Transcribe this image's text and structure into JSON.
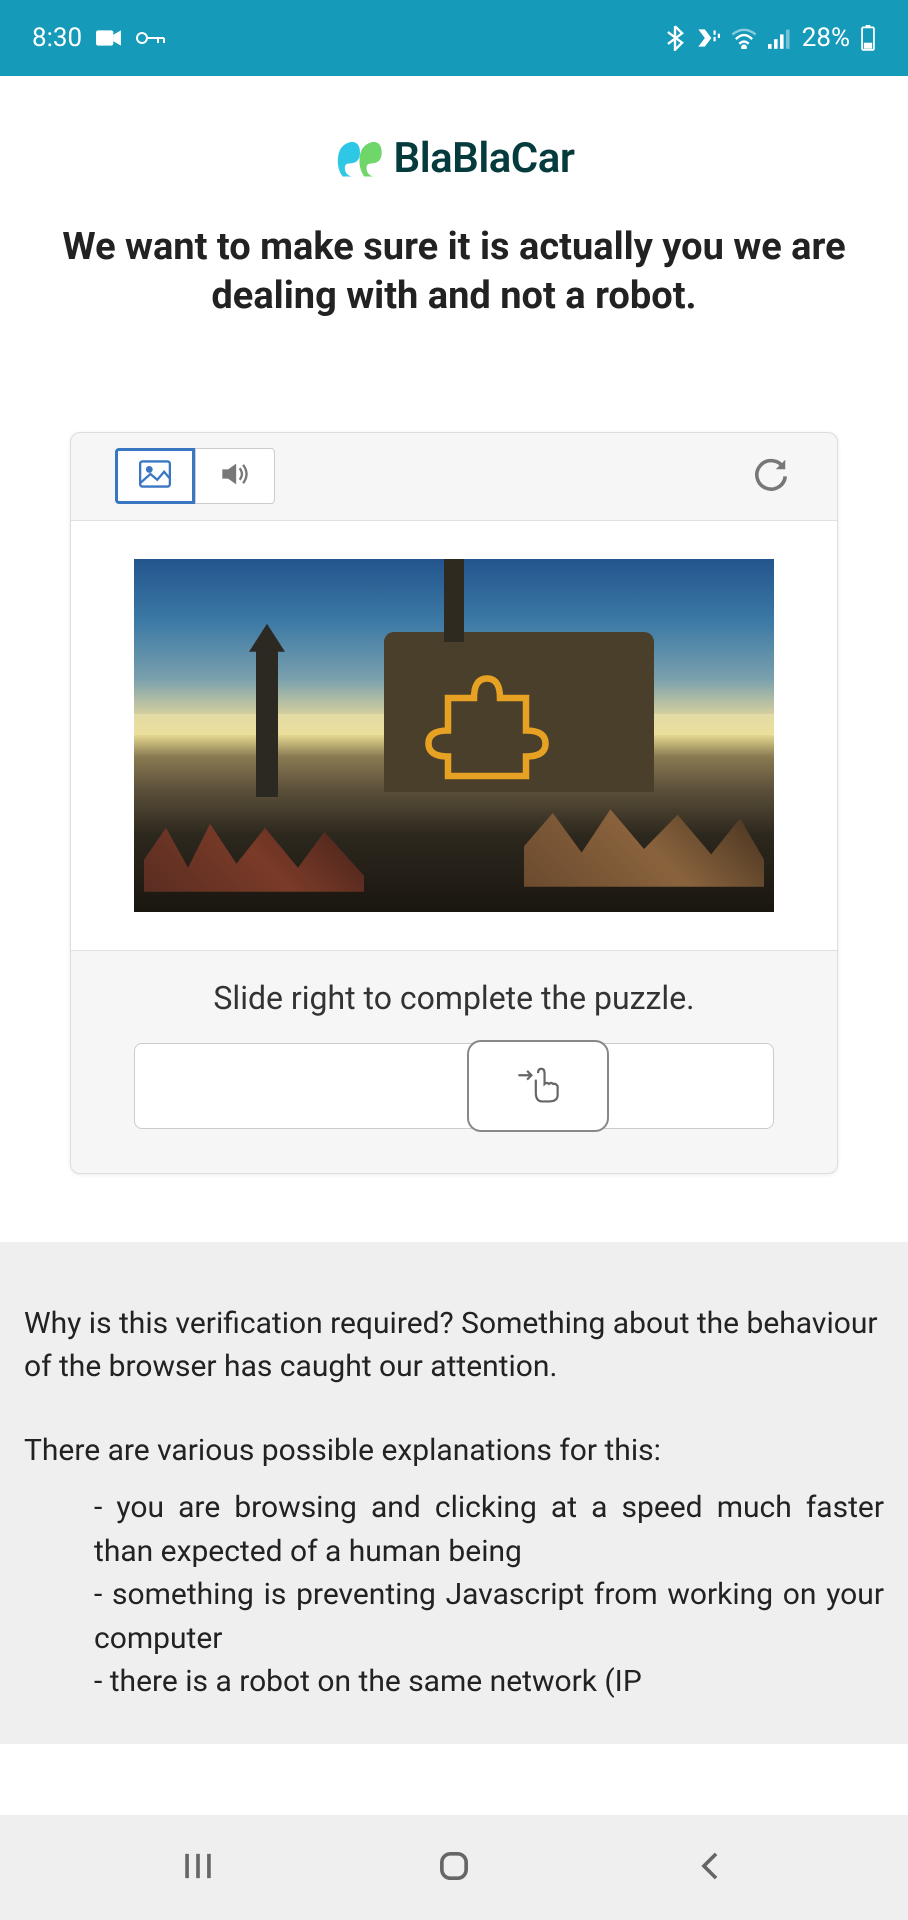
{
  "statusbar": {
    "time": "8:30",
    "battery_pct": "28%"
  },
  "brand": "BlaBlaCar",
  "heading": "We want to make sure it is actually you we are dealing with and not a robot.",
  "captcha": {
    "instruction": "Slide right to complete the puzzle."
  },
  "explain": {
    "intro": "Why is this verification required? Something about the behaviour of the browser has caught our attention.",
    "lead": "There are various possible explanations for this:",
    "items": [
      "you are browsing and clicking at a speed much faster than expected of a human being",
      "something is preventing Javascript from working on your computer",
      "there is a robot on the same network (IP"
    ]
  }
}
